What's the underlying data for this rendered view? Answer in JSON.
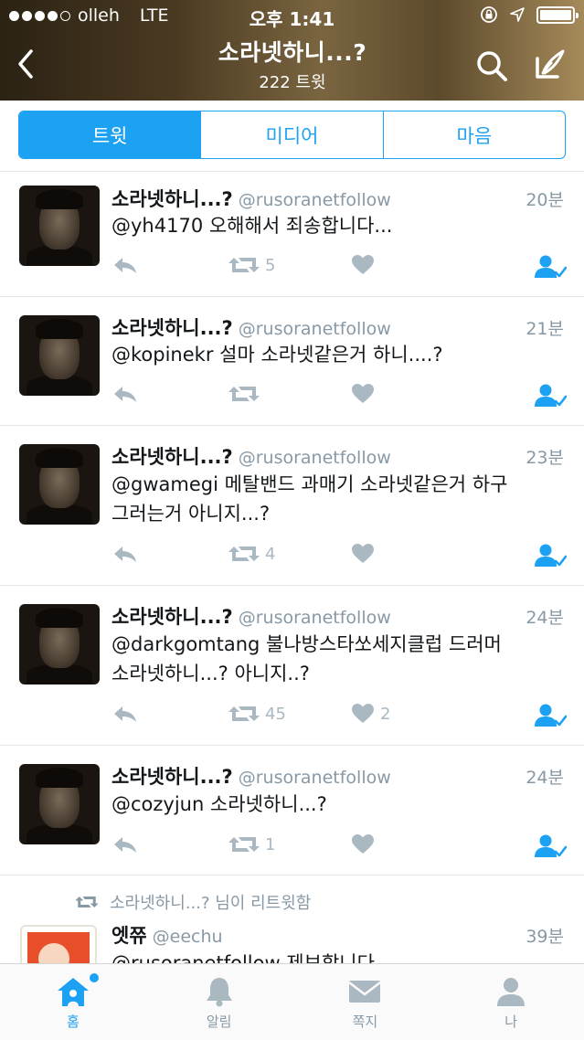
{
  "status_bar": {
    "carrier": "olleh",
    "network": "LTE",
    "time": "오후 1:41"
  },
  "header": {
    "title": "소라넷하니...?",
    "subtitle": "222 트윗",
    "icons": [
      "back-chevron-icon",
      "search-icon",
      "compose-icon"
    ]
  },
  "tabs": [
    {
      "label": "트윗",
      "active": true
    },
    {
      "label": "미디어",
      "active": false
    },
    {
      "label": "마음",
      "active": false
    }
  ],
  "tweets": [
    {
      "name": "소라넷하니...?",
      "handle": "@rusoranetfollow",
      "time": "20분",
      "text": [
        "@yh4170 오해해서 죄송합니다..."
      ],
      "retweets": "5",
      "likes": ""
    },
    {
      "name": "소라넷하니...?",
      "handle": "@rusoranetfollow",
      "time": "21분",
      "text": [
        "@kopinekr 설마 소라넷같은거 하니....?"
      ],
      "retweets": "",
      "likes": ""
    },
    {
      "name": "소라넷하니...?",
      "handle": "@rusoranetfollow",
      "time": "23분",
      "text": [
        "@gwamegi 메탈밴드 과매기 소라넷같은거 하구",
        "그러는거 아니지...?"
      ],
      "retweets": "4",
      "likes": ""
    },
    {
      "name": "소라넷하니...?",
      "handle": "@rusoranetfollow",
      "time": "24분",
      "text": [
        "@darkgomtang 불나방스타쏘세지클럽 드러머",
        "소라넷하니...? 아니지..?"
      ],
      "retweets": "45",
      "likes": "2"
    },
    {
      "name": "소라넷하니...?",
      "handle": "@rusoranetfollow",
      "time": "24분",
      "text": [
        "@cozyjun 소라넷하니...?"
      ],
      "retweets": "1",
      "likes": ""
    }
  ],
  "retweet_item": {
    "note": "소라넷하니...? 님이 리트윗함",
    "name": "엣쮸",
    "handle": "@eechu",
    "time": "39분",
    "text": "@rusoranetfollow 제보합니다"
  },
  "tabbar": [
    {
      "label": "홈",
      "icon": "home-icon",
      "active": true
    },
    {
      "label": "알림",
      "icon": "bell-icon",
      "active": false
    },
    {
      "label": "쪽지",
      "icon": "envelope-icon",
      "active": false
    },
    {
      "label": "나",
      "icon": "person-icon",
      "active": false
    }
  ],
  "colors": {
    "accent": "#1da1f2",
    "muted": "#8899a6",
    "icon_gray": "#aab8c2",
    "text": "#14171a"
  }
}
